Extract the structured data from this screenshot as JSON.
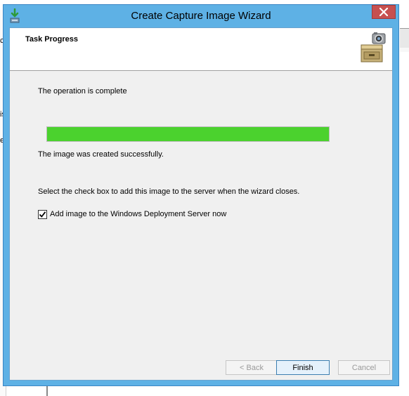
{
  "window": {
    "title": "Create Capture Image Wizard",
    "close_glyph": "✕"
  },
  "header": {
    "title": "Task Progress",
    "icon": "file-cabinet-camera-icon"
  },
  "content": {
    "status_text": "The operation is complete",
    "progress": 1.0,
    "result_text": "The image was created successfully.",
    "instruction_text": "Select the check box to add this image to the server when the wizard closes.",
    "checkbox_label": "Add image to the Windows Deployment Server now",
    "checkbox_checked": true
  },
  "buttons": {
    "back_label": "< Back",
    "finish_label": "Finish",
    "cancel_label": "Cancel"
  },
  "background": {
    "fragments": [
      "ce",
      "is",
      "ed"
    ]
  },
  "colors": {
    "progress_fill": "#4bd22e",
    "title_bar": "#5eb1e5",
    "close_button": "#c75050"
  }
}
